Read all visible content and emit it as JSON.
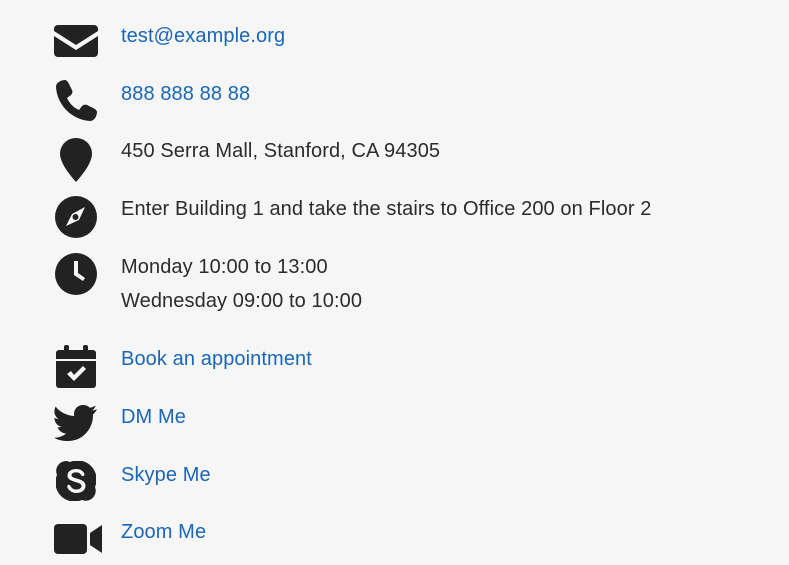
{
  "contact": {
    "email": "test@example.org",
    "phone": "888 888 88 88",
    "address": "450 Serra Mall, Stanford, CA 94305",
    "directions": "Enter Building 1 and take the stairs to Office 200 on Floor 2",
    "hours": [
      "Monday 10:00 to 13:00",
      "Wednesday 09:00 to 10:00"
    ],
    "appointment_label": "Book an appointment",
    "twitter_label": "DM Me",
    "skype_label": "Skype Me",
    "zoom_label": "Zoom Me"
  },
  "icons": {
    "email": "envelope-icon",
    "phone": "phone-icon",
    "address": "map-marker-icon",
    "directions": "compass-icon",
    "hours": "clock-icon",
    "appointment": "calendar-check-icon",
    "twitter": "twitter-icon",
    "skype": "skype-icon",
    "zoom": "video-camera-icon"
  },
  "colors": {
    "background": "#f6f6f6",
    "text": "#2b2b2b",
    "link": "#1a66b8",
    "icon": "#222222"
  }
}
